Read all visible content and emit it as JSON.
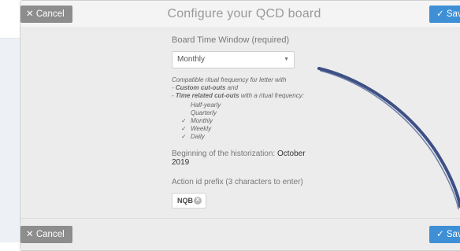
{
  "header": {
    "title": "Configure your QCD board",
    "cancel_label": "Cancel",
    "save_label": "Save"
  },
  "footer": {
    "cancel_label": "Cancel",
    "save_label": "Save"
  },
  "board_time_window": {
    "label": "Board Time Window (required)",
    "selected": "Monthly"
  },
  "compat_note": {
    "line1": "Compatible ritual frequency for letter with",
    "line2_prefix": "- ",
    "line2_strong": "Custom cut-outs",
    "line2_suffix": " and",
    "line3_prefix": "- ",
    "line3_strong": "Time related cut-outs",
    "line3_suffix": " with a ritual frequency:"
  },
  "frequencies": [
    {
      "label": "Half-yearly",
      "checked": false
    },
    {
      "label": "Quarterly",
      "checked": false
    },
    {
      "label": "Monthly",
      "checked": true
    },
    {
      "label": "Weekly",
      "checked": true
    },
    {
      "label": "Daily",
      "checked": true
    }
  ],
  "historization": {
    "label": "Beginning of the historization:",
    "value": "October 2019"
  },
  "action_prefix": {
    "label": "Action id prefix (3 characters to enter)",
    "value": "NQB"
  },
  "colors": {
    "save_button": "#3e8fd6",
    "cancel_button": "#8d8d8d",
    "scribble": "#2a3f7a"
  },
  "icons": {
    "cancel": "close-icon",
    "save": "check-icon",
    "dropdown": "caret-down-icon",
    "clear": "clear-circle-icon"
  }
}
